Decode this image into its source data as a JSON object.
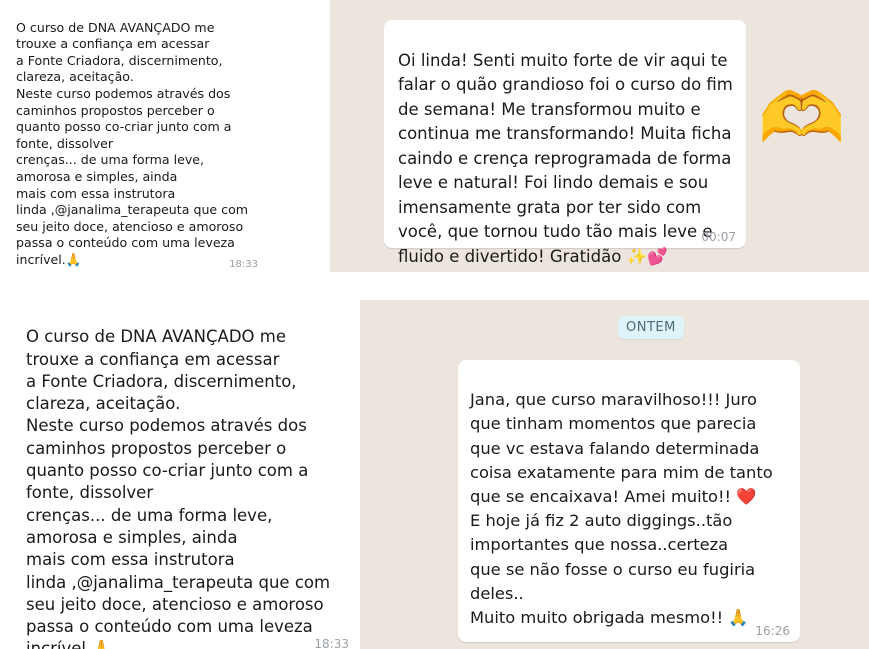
{
  "screenshots": {
    "top_left": {
      "message": "O curso de DNA AVANÇADO me\ntrouxe a confiança em acessar\na Fonte Criadora, discernimento,\nclareza, aceitação.\nNeste curso podemos através dos\ncaminhos propostos perceber o\nquanto posso co-criar junto com a\nfonte, dissolver\ncrenças... de uma forma leve,\namorosa e simples, ainda\nmais com essa instrutora\nlinda ,@janalima_terapeuta que com\nseu jeito doce, atencioso e amoroso\npassa o conteúdo com uma leveza\nincrível.",
      "emoji": "🙏",
      "time": "18:33"
    },
    "top_right": {
      "message": "Oi linda! Senti muito forte de vir aqui te\nfalar o quão grandioso foi o curso do fim\nde semana! Me transformou muito e\ncontinua me transformando! Muita ficha\ncaindo e crença reprogramada de forma\nleve e natural! Foi lindo demais e sou\nimensamente grata por ter sido com\nvocê, que tornou tudo tão mais leve e\nfluido e divertido! Gratidão",
      "emoji": "✨💕",
      "time": "00:07",
      "sticker": "🫶"
    },
    "bottom_left": {
      "message": "O curso de DNA AVANÇADO me\ntrouxe a confiança em acessar\na Fonte Criadora, discernimento,\nclareza, aceitação.\nNeste curso podemos através dos\ncaminhos propostos perceber o\nquanto posso co-criar junto com a\nfonte, dissolver\ncrenças... de uma forma leve,\namorosa e simples, ainda\nmais com essa instrutora\nlinda ,@janalima_terapeuta que com\nseu jeito doce, atencioso e amoroso\npassa o conteúdo com uma leveza\nincrível.",
      "emoji": "🙏",
      "time": "18:33"
    },
    "bottom_right": {
      "date_badge": "ONTEM",
      "message_a": "Jana, que curso maravilhoso!!! Juro\nque tinham momentos que parecia\nque vc estava falando determinada\ncoisa exatamente para mim de tanto\nque se encaixava! Amei muito!!",
      "heart": "❤️",
      "message_b": "E hoje já fiz 2 auto diggings..tão\nimportantes que nossa..certeza\nque se não fosse o curso eu fugiria\ndeles..",
      "message_c": "Muito muito obrigada mesmo!!",
      "emoji": "🙏",
      "time": "16:26"
    }
  }
}
